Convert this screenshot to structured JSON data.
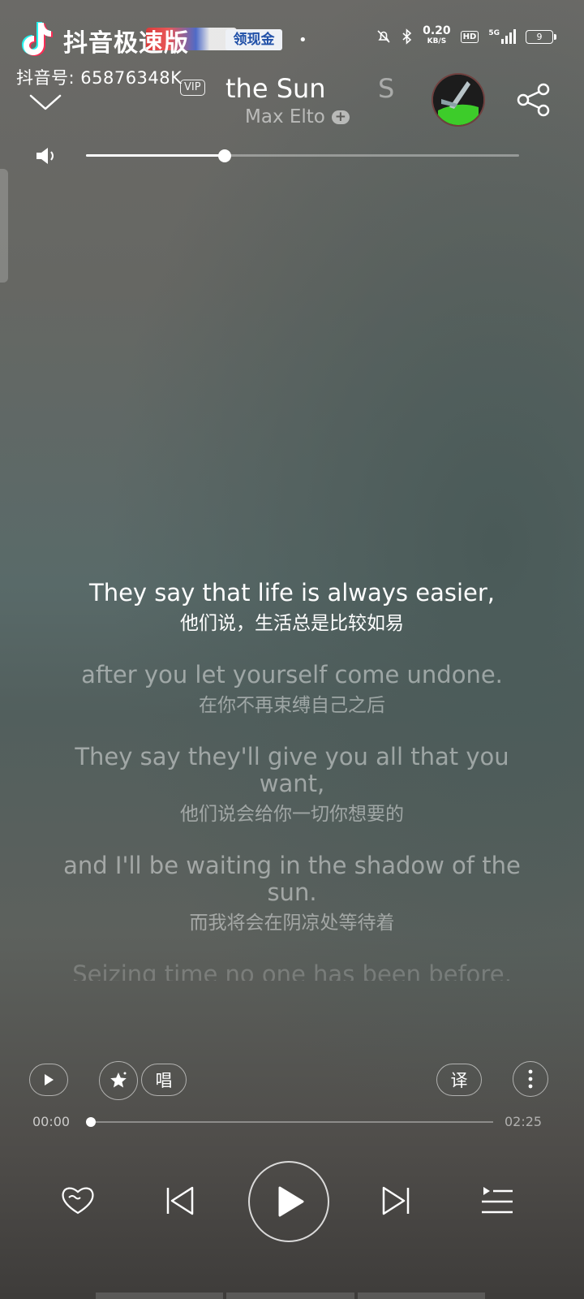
{
  "watermark": {
    "app_name": "抖音极速版",
    "badge_text": "领现金",
    "user_id": "抖音号: 65876348K"
  },
  "status_bar": {
    "speed_value": "0.20",
    "speed_unit": "KB/S",
    "hd": "HD",
    "network": "5G",
    "battery": "9"
  },
  "header": {
    "vip_label": "VIP",
    "song_title": "the Sun",
    "next_title_fragment": "S",
    "artist": "Max Elto",
    "follow_label": "+"
  },
  "volume": {
    "level": 0.32
  },
  "lyrics": [
    {
      "en": "They say that life is always easier,",
      "zh": "他们说，生活总是比较如易",
      "state": "active"
    },
    {
      "en": "after you let yourself come undone.",
      "zh": "在你不再束缚自己之后",
      "state": "dim"
    },
    {
      "en": "They say they'll give you all that you want,",
      "zh": "他们说会给你一切你想要的",
      "state": "dim"
    },
    {
      "en": "and I'll be waiting in the shadow of the sun.",
      "zh": "而我将会在阴凉处等待着",
      "state": "dim"
    },
    {
      "en": "Seizing time no one has been before,",
      "zh": "",
      "state": "fade"
    }
  ],
  "controls": {
    "sing_label": "唱",
    "translate_label": "译"
  },
  "progress": {
    "current": "00:00",
    "total": "02:25",
    "fraction": 0.0
  },
  "icons": {
    "chevron": "chevron-down-icon",
    "share": "share-icon",
    "volume": "volume-icon",
    "heart": "heart-icon",
    "prev": "previous-icon",
    "play": "play-icon",
    "next": "next-icon",
    "queue": "playlist-icon",
    "more": "more-vertical-icon",
    "star": "star-sparkle-icon"
  }
}
